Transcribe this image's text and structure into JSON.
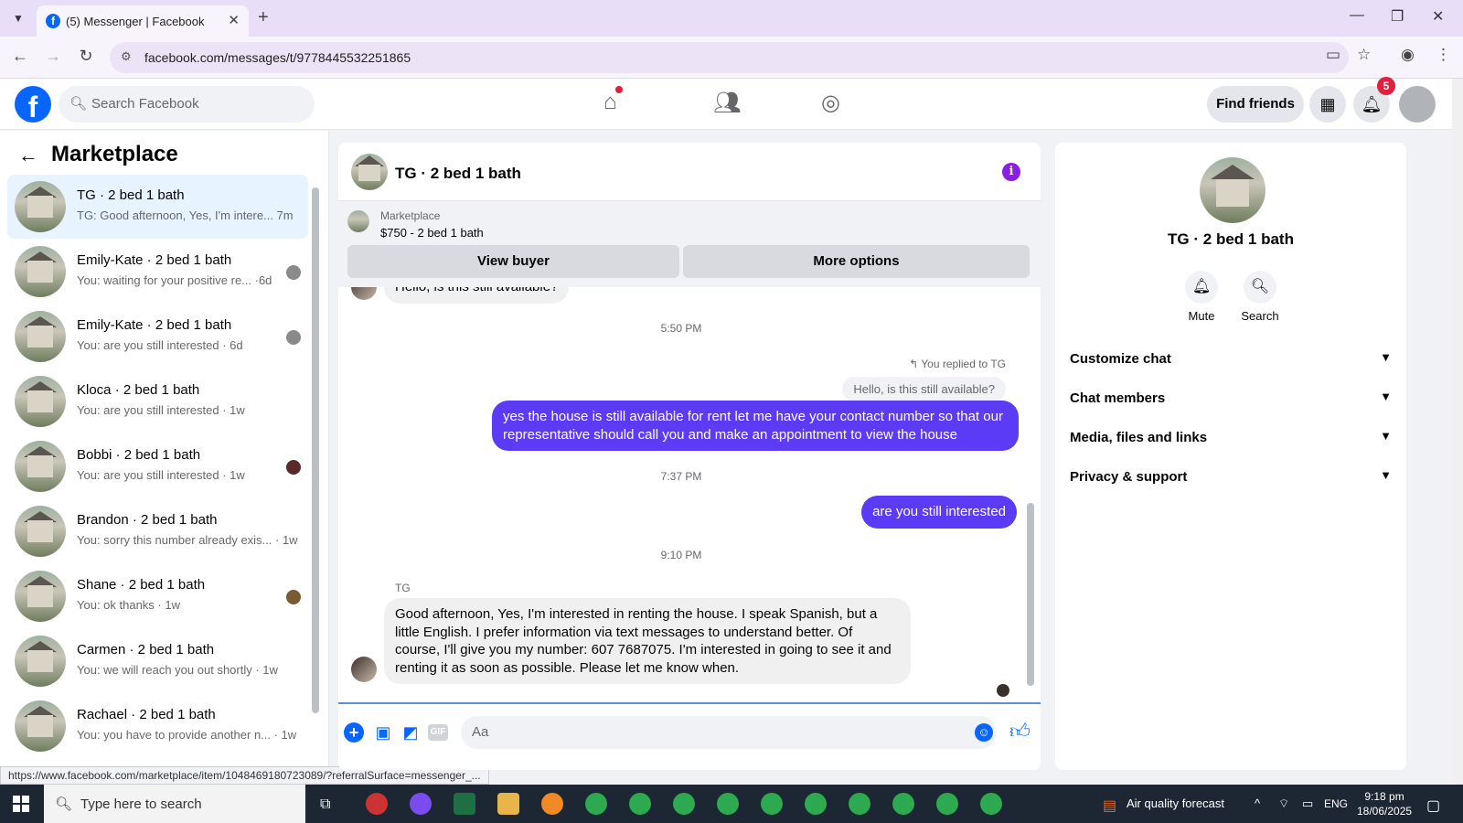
{
  "browser": {
    "tab_title": "(5) Messenger | Facebook",
    "favicon": "f",
    "new_tab": "+",
    "url": "facebook.com/messages/t/9778445532251865",
    "minimize": "—",
    "restore": "❐",
    "close": "✕"
  },
  "fb": {
    "logo": "f",
    "search_placeholder": "Search Facebook",
    "find_friends": "Find friends",
    "notif_count": "5"
  },
  "left": {
    "title": "Marketplace",
    "chats": [
      {
        "name": "TG · 2 bed 1 bath",
        "preview": "TG: Good afternoon, Yes, I'm intere... 7m"
      },
      {
        "name": "Emily-Kate · 2 bed 1 bath",
        "preview": "You: waiting for your positive re... ·6d"
      },
      {
        "name": "Emily-Kate · 2 bed 1 bath",
        "preview": "You: are you still interested · 6d"
      },
      {
        "name": "Kloca · 2 bed 1 bath",
        "preview": "You: are you still interested · 1w"
      },
      {
        "name": "Bobbi · 2 bed 1 bath",
        "preview": "You: are you still interested · 1w"
      },
      {
        "name": "Brandon · 2 bed 1 bath",
        "preview": "You: sorry this number already exis... · 1w"
      },
      {
        "name": "Shane · 2 bed 1 bath",
        "preview": "You: ok thanks · 1w"
      },
      {
        "name": "Carmen · 2 bed 1 bath",
        "preview": "You: we will reach you out shortly · 1w"
      },
      {
        "name": "Rachael · 2 bed 1 bath",
        "preview": "You: you have to provide another n... · 1w"
      }
    ],
    "status_url": "https://www.facebook.com/marketplace/item/1048469180723089/?referralSurface=messenger_..."
  },
  "chat": {
    "title": "TG · 2 bed 1 bath",
    "marketplace_label": "Marketplace",
    "listing": "$750 - 2 bed 1 bath",
    "view_buyer": "View buyer",
    "more_options": "More options",
    "msg_top": "Hello, is this still available?",
    "time1": "5:50 PM",
    "replied_label": "You replied to TG",
    "quote": "Hello, is this still available?",
    "out1": "yes the house is still available for rent let me have your contact number so that our representative should call you and make an appointment to view the house",
    "time2": "7:37 PM",
    "out2": "are you still interested",
    "time3": "9:10 PM",
    "sender": "TG",
    "in1": "Good afternoon, Yes, I'm interested in renting the house. I speak Spanish, but a little English. I prefer information via text messages to understand better. Of course, I'll give you my number: 607 7687075. I'm interested in going to see it and renting it as soon as possible. Please let me know when.",
    "composer_placeholder": "Aa",
    "gif_label": "GIF"
  },
  "right": {
    "name": "TG · 2 bed 1 bath",
    "mute": "Mute",
    "search": "Search",
    "sections": [
      "Customize chat",
      "Chat members",
      "Media, files and links",
      "Privacy & support"
    ]
  },
  "taskbar": {
    "search_placeholder": "Type here to search",
    "weather": "Air quality forecast",
    "lang": "ENG",
    "time": "9:18 pm",
    "date": "18/06/2025"
  },
  "colors": {
    "accent": "#0866ff",
    "outgoing_bubble": "#5b3bf5",
    "info_purple": "#8a1ee5"
  }
}
